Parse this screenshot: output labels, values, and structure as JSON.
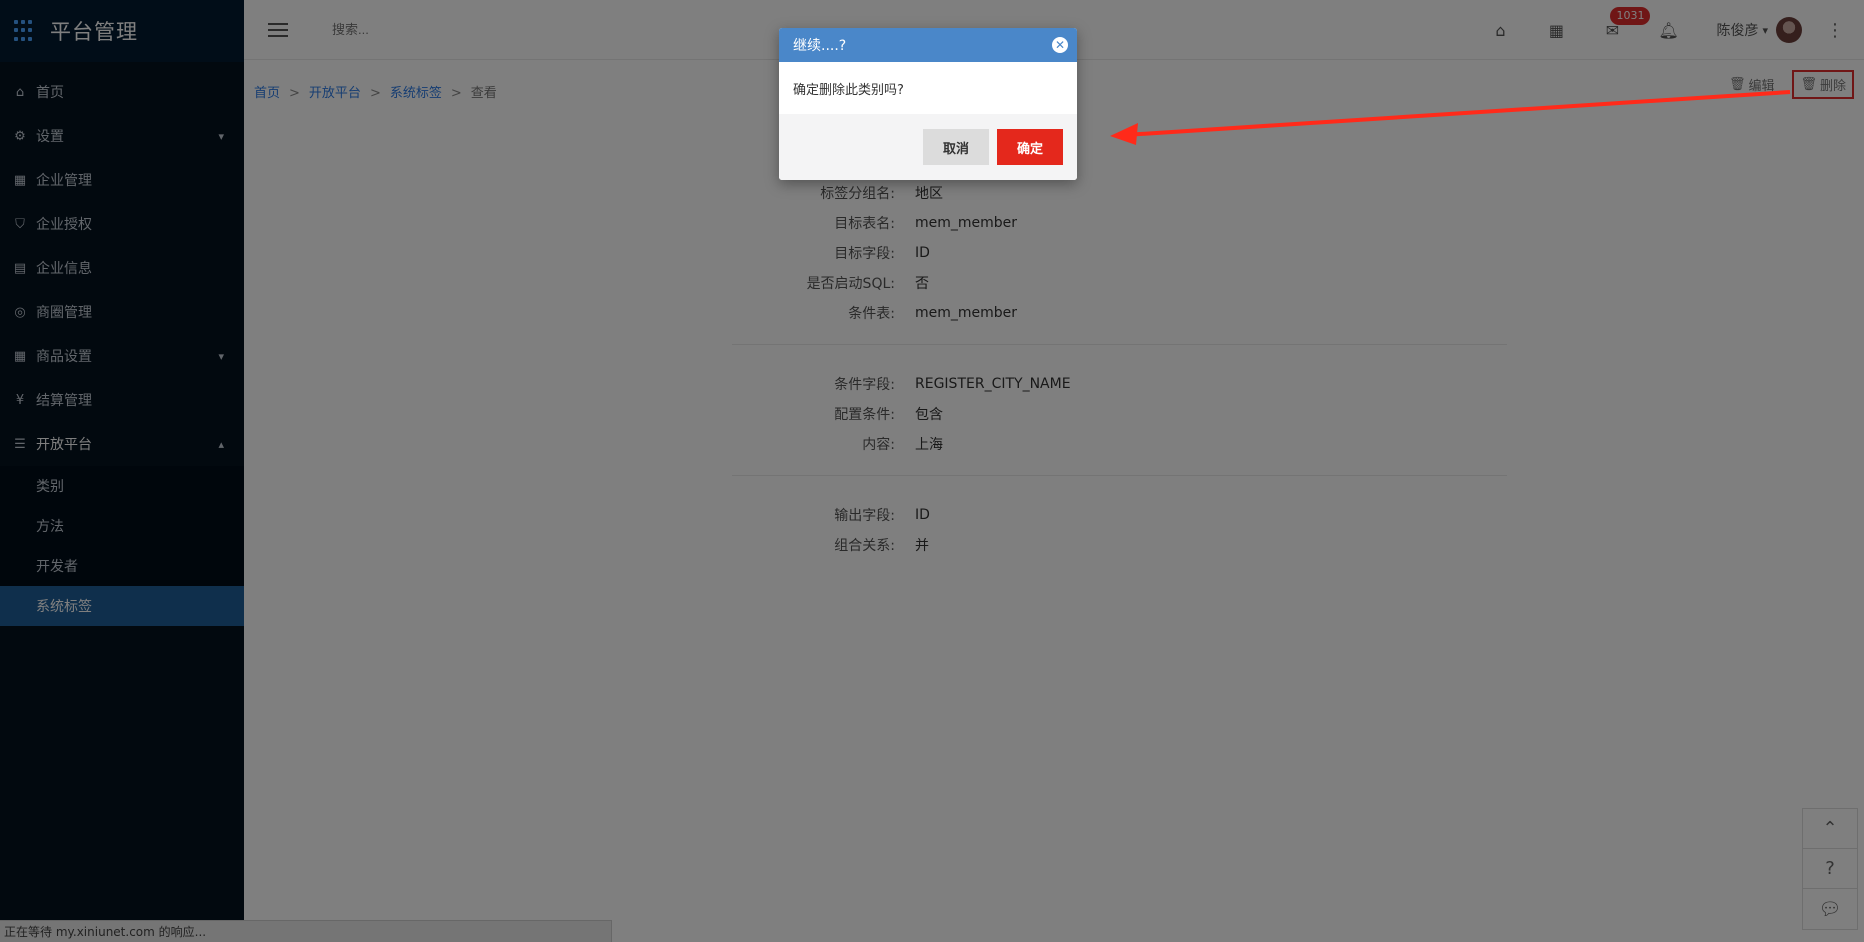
{
  "app": {
    "title": "平台管理"
  },
  "sidebar": {
    "items": [
      {
        "label": "首页",
        "icon": "home-icon"
      },
      {
        "label": "设置",
        "icon": "gear-icon",
        "caret": "down"
      },
      {
        "label": "企业管理",
        "icon": "grid-icon"
      },
      {
        "label": "企业授权",
        "icon": "shield-icon"
      },
      {
        "label": "企业信息",
        "icon": "id-card-icon"
      },
      {
        "label": "商圈管理",
        "icon": "compass-icon"
      },
      {
        "label": "商品设置",
        "icon": "grid-icon",
        "caret": "down"
      },
      {
        "label": "结算管理",
        "icon": "yen-icon"
      },
      {
        "label": "开放平台",
        "icon": "table-icon",
        "caret": "up"
      }
    ],
    "subitems": [
      {
        "label": "类别"
      },
      {
        "label": "方法"
      },
      {
        "label": "开发者"
      },
      {
        "label": "系统标签"
      }
    ]
  },
  "topbar": {
    "search_placeholder": "搜索...",
    "badge_count": "1031",
    "user_name": "陈俊彦"
  },
  "breadcrumb": {
    "items": [
      "首页",
      "开放平台",
      "系统标签"
    ],
    "current": "查看"
  },
  "actions": {
    "edit": "编辑",
    "delete": "删除"
  },
  "details": {
    "group1": [
      {
        "label": "标签分组名:",
        "value": "地区"
      },
      {
        "label": "目标表名:",
        "value": "mem_member"
      },
      {
        "label": "目标字段:",
        "value": "ID"
      },
      {
        "label": "是否启动SQL:",
        "value": "否"
      },
      {
        "label": "条件表:",
        "value": "mem_member"
      }
    ],
    "group2": [
      {
        "label": "条件字段:",
        "value": "REGISTER_CITY_NAME"
      },
      {
        "label": "配置条件:",
        "value": "包含"
      },
      {
        "label": "内容:",
        "value": "上海"
      }
    ],
    "group3": [
      {
        "label": "输出字段:",
        "value": "ID"
      },
      {
        "label": "组合关系:",
        "value": "并"
      }
    ]
  },
  "status_bar": {
    "text": "正在等待 my.xiniunet.com 的响应..."
  },
  "modal": {
    "title": "继续....?",
    "message": "确定删除此类别吗?",
    "cancel_label": "取消",
    "ok_label": "确定"
  },
  "colors": {
    "sidebar_bg": "#04121f",
    "active_item": "#1f5f99",
    "modal_header": "#4a87c9",
    "danger": "#e4281c",
    "link": "#2c7be5"
  }
}
